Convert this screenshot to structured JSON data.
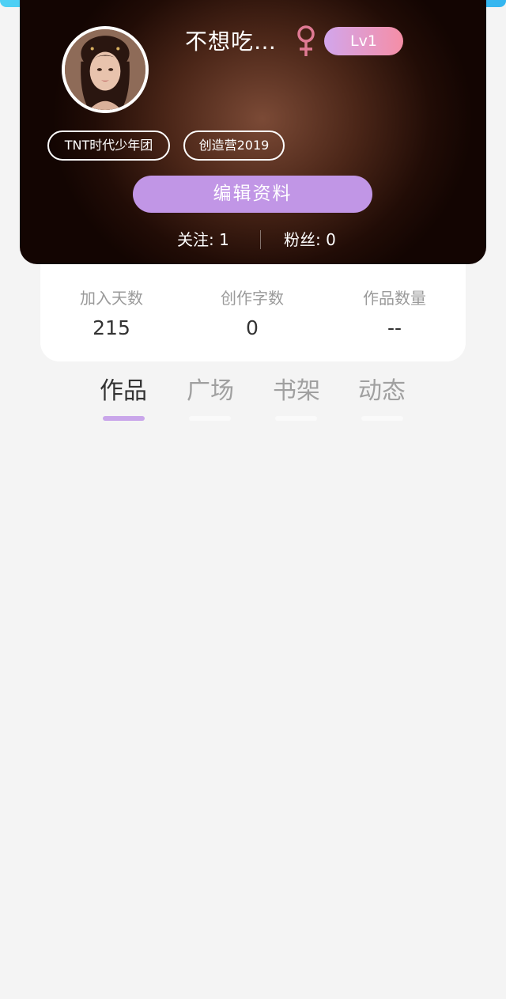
{
  "profile": {
    "username": "不想吃…",
    "gender_icon": "female-symbol-icon",
    "level": "Lv1",
    "tags": [
      "TNT时代少年团",
      "创造营2019"
    ],
    "edit_button": "编辑资料",
    "following": "关注: 1",
    "followers": "粉丝: 0"
  },
  "stats": [
    {
      "label": "加入天数",
      "value": "215"
    },
    {
      "label": "创作字数",
      "value": "0"
    },
    {
      "label": "作品数量",
      "value": "--"
    }
  ],
  "tabs": [
    {
      "label": "作品",
      "active": true
    },
    {
      "label": "广场",
      "active": false
    },
    {
      "label": "书架",
      "active": false
    },
    {
      "label": "动态",
      "active": false
    }
  ],
  "colors": {
    "accent": "#c196e6",
    "level_badge_start": "#d2a6ec",
    "level_badge_end": "#f58ea6",
    "gender_icon": "#e07a94",
    "top_bar": "#35b6f0"
  }
}
